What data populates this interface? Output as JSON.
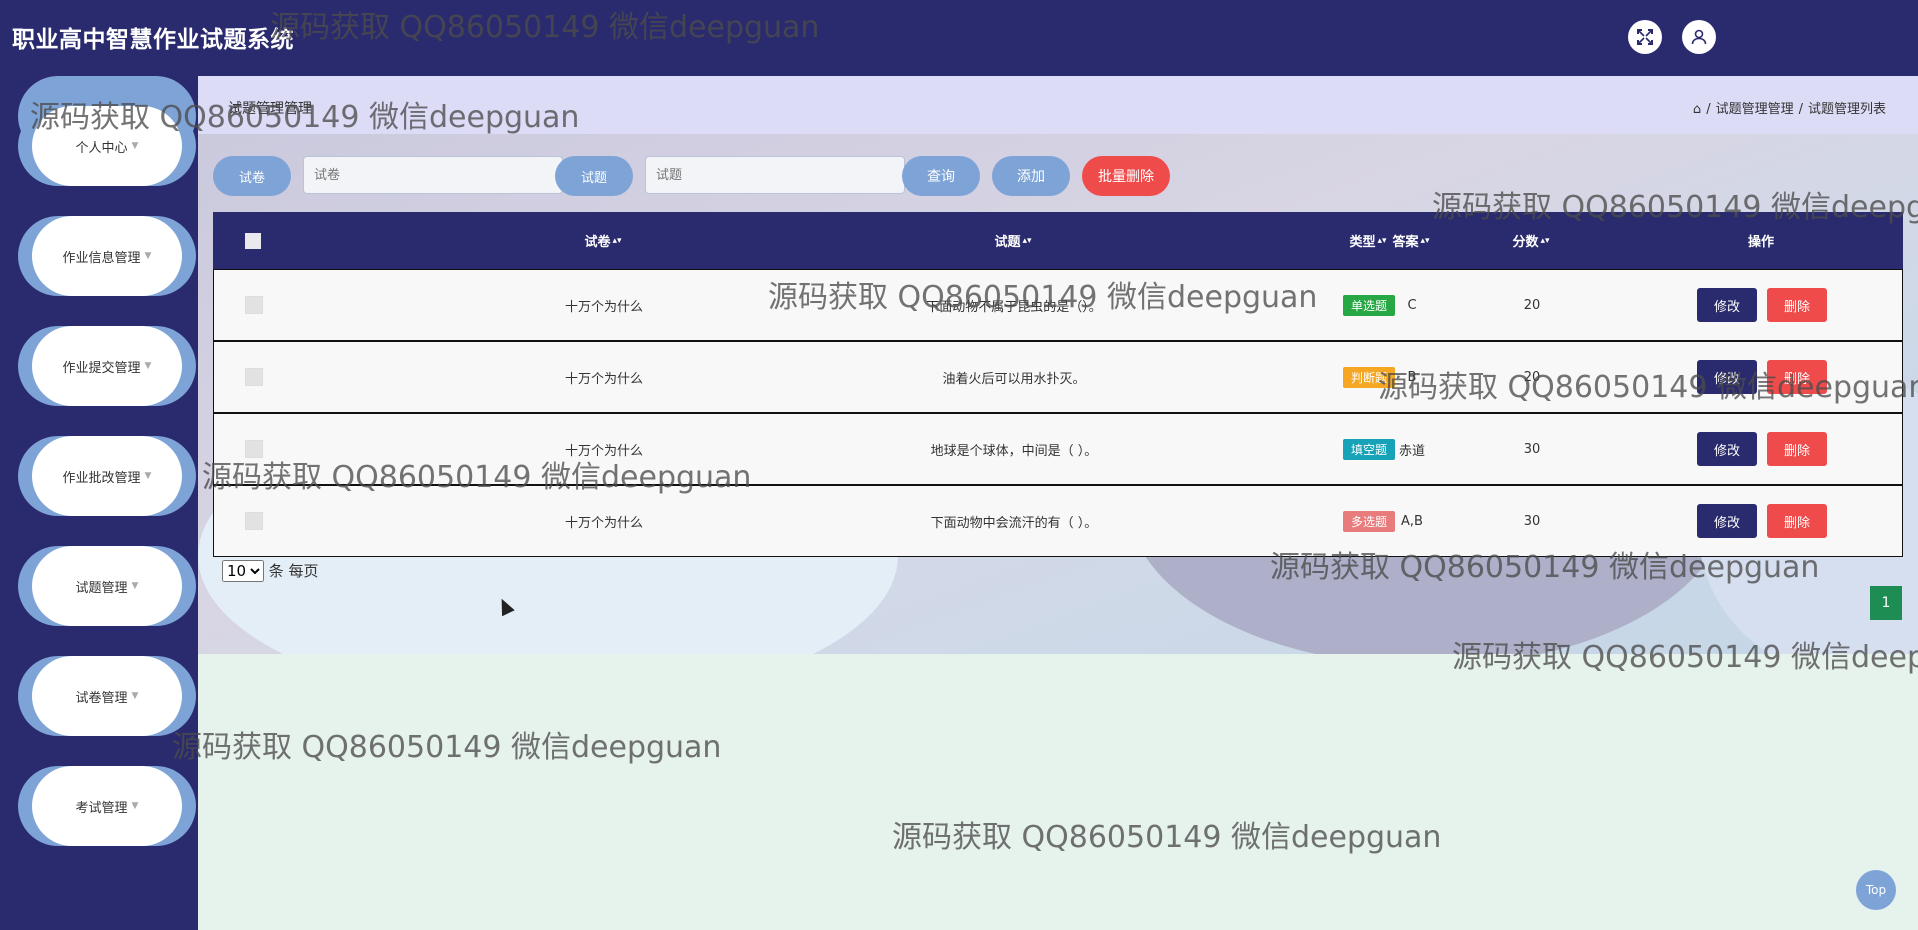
{
  "header": {
    "app_title": "职业高中智慧作业试题系统",
    "icons": [
      "fullscreen-icon",
      "user-icon"
    ]
  },
  "sidebar": {
    "items": [
      {
        "label": "个人中心"
      },
      {
        "label": "作业信息管理"
      },
      {
        "label": "作业提交管理"
      },
      {
        "label": "作业批改管理"
      },
      {
        "label": "试题管理"
      },
      {
        "label": "试卷管理"
      },
      {
        "label": "考试管理"
      }
    ]
  },
  "breadcrumb": {
    "page_title": "试题管理管理",
    "path": [
      "试题管理管理",
      "试题管理列表"
    ],
    "separator": "/"
  },
  "search": {
    "paper_label": "试卷",
    "paper_placeholder": "试卷",
    "question_label": "试题",
    "question_placeholder": "试题",
    "query_button": "查询",
    "add_button": "添加",
    "batch_delete_button": "批量删除"
  },
  "table": {
    "headers": {
      "paper": "试卷",
      "question": "试题",
      "type": "类型",
      "answer": "答案",
      "score": "分数",
      "actions": "操作"
    },
    "edit_label": "修改",
    "delete_label": "删除",
    "rows": [
      {
        "paper": "十万个为什么",
        "question": "下面动物不属于昆虫的是（）。",
        "type": "单选题",
        "type_color": "#28a745",
        "answer": "C",
        "score": "20"
      },
      {
        "paper": "十万个为什么",
        "question": "油着火后可以用水扑灭。",
        "type": "判断题",
        "type_color": "#f5a623",
        "answer": "B",
        "score": "20"
      },
      {
        "paper": "十万个为什么",
        "question": "地球是个球体，中间是（ ）。",
        "type": "填空题",
        "type_color": "#17a2b8",
        "answer": "赤道",
        "score": "30"
      },
      {
        "paper": "十万个为什么",
        "question": "下面动物中会流汗的有（ ）。",
        "type": "多选题",
        "type_color": "#e87c7c",
        "answer": "A,B",
        "score": "30"
      }
    ]
  },
  "pagination": {
    "page_size": "10",
    "suffix": "条 每页",
    "current_page": "1"
  },
  "top_button": "Top",
  "watermark": "源码获取 QQ86050149 微信deepguan"
}
